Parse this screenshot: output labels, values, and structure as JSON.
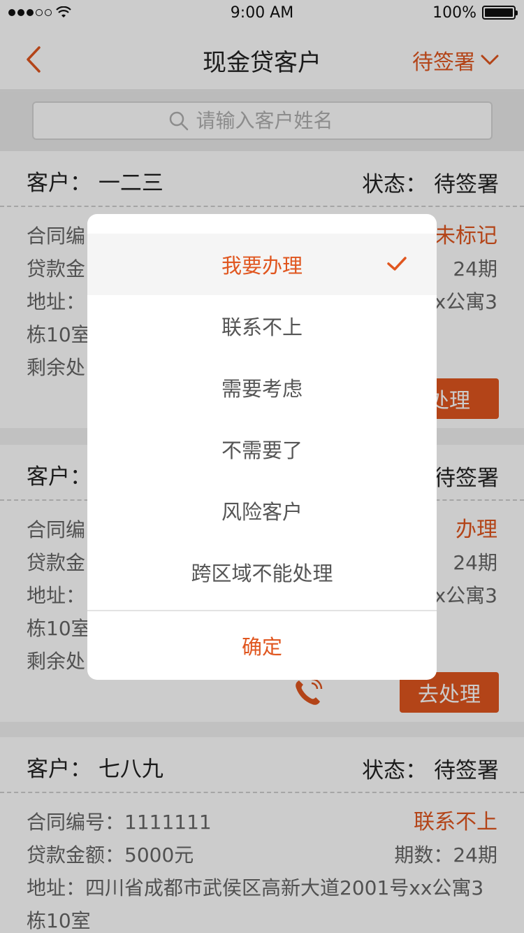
{
  "status_bar": {
    "time": "9:00 AM",
    "battery": "100%"
  },
  "nav": {
    "title": "现金贷客户",
    "filter_label": "待签署"
  },
  "search": {
    "placeholder": "请输入客户姓名"
  },
  "labels": {
    "customer": "客户：",
    "status": "状态：",
    "contract_no": "合同编号：",
    "loan_amount": "贷款金额：",
    "periods": "期数：",
    "address": "地址：",
    "remaining": "剩余处理时间："
  },
  "cards": [
    {
      "customer_full": "客户： 一二三",
      "status_full": "状态： 待签署",
      "contract": "合同编",
      "tag": "未标记",
      "loan": "贷款金",
      "periods": "： 24期",
      "addr1": "地址：",
      "addr1_tail": "x公寓3",
      "addr2": "栋10室",
      "remaining": "剩余处",
      "button": "处理"
    },
    {
      "customer_full": "客户：",
      "status_full": "待签署",
      "contract": "合同编",
      "tag": "办理",
      "loan": "贷款金",
      "periods": "24期",
      "addr1": "地址：",
      "addr1_tail": "x公寓3",
      "addr2": "栋10室",
      "remaining": "剩余处",
      "button": "去处理"
    },
    {
      "customer_full": "客户： 七八九",
      "status_full": "状态： 待签署",
      "contract": "合同编号：1111111",
      "tag": "联系不上",
      "loan": "贷款金额：5000元",
      "periods": "期数：24期",
      "addr1": "地址：四川省成都市武侯区高新大道2001号xx公寓3",
      "addr2": "栋10室"
    }
  ],
  "dialog": {
    "options": [
      "我要办理",
      "联系不上",
      "需要考虑",
      "不需要了",
      "风险客户",
      "跨区域不能处理"
    ],
    "selected_index": 0,
    "confirm": "确定"
  },
  "colors": {
    "accent": "#e0561f",
    "text": "#222222",
    "muted": "#666666",
    "background": "#f2f2f2"
  },
  "icons": [
    "back-icon",
    "chevron-down-icon",
    "search-icon",
    "check-icon",
    "phone-icon",
    "wifi-icon",
    "battery-icon"
  ]
}
